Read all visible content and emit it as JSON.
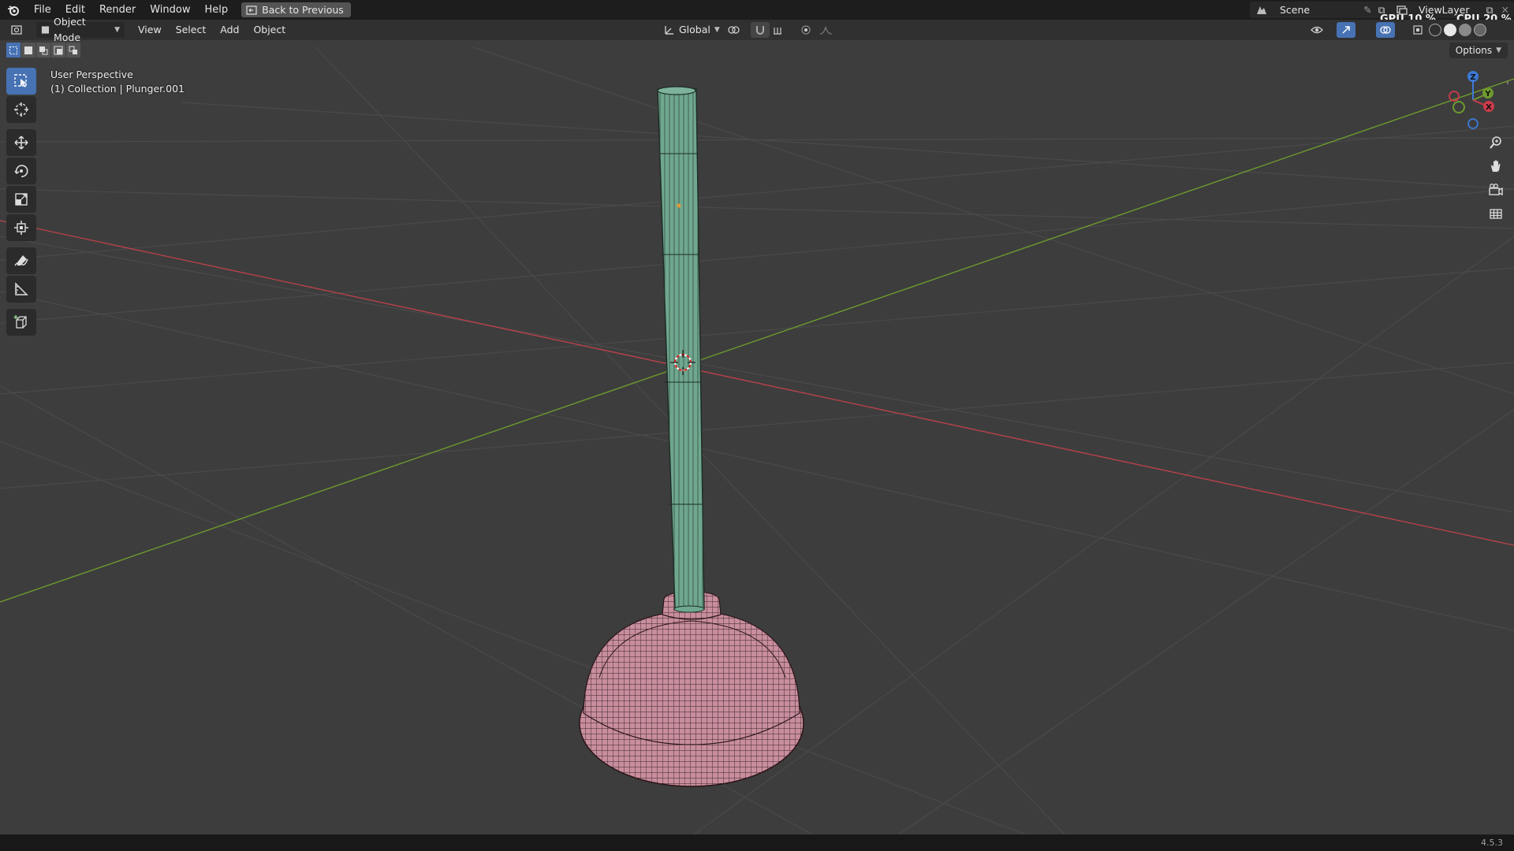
{
  "topbar": {
    "menus": [
      "File",
      "Edit",
      "Render",
      "Window",
      "Help"
    ],
    "back_label": "Back to Previous",
    "scene_label": "Scene",
    "viewlayer_label": "ViewLayer",
    "gpu_label": "GPU",
    "gpu_value": "10 %",
    "cpu_label": "CPU",
    "cpu_value": "20 %"
  },
  "header": {
    "mode_label": "Object Mode",
    "menus": [
      "View",
      "Select",
      "Add",
      "Object"
    ],
    "orientation_label": "Global"
  },
  "viewport": {
    "perspective_label": "User Perspective",
    "collection_label": "(1) Collection | Plunger.001",
    "options_label": "Options",
    "gizmo_axes": [
      "Z",
      "Y",
      "X"
    ]
  },
  "status": {
    "version": "4.5.3"
  },
  "colors": {
    "handle": "#6fa78f",
    "cup": "#c88e9e",
    "x_axis": "#b5414a",
    "y_axis": "#6e9a2e",
    "accent": "#4772b3"
  },
  "icons": {
    "app": "blender-logo-icon",
    "tools": [
      "select-box-icon",
      "cursor-icon",
      "move-icon",
      "rotate-icon",
      "scale-icon",
      "transform-icon",
      "annotate-icon",
      "measure-icon",
      "add-cube-icon"
    ],
    "nav": [
      "zoom-icon",
      "pan-hand-icon",
      "camera-icon",
      "grid-icon"
    ]
  }
}
